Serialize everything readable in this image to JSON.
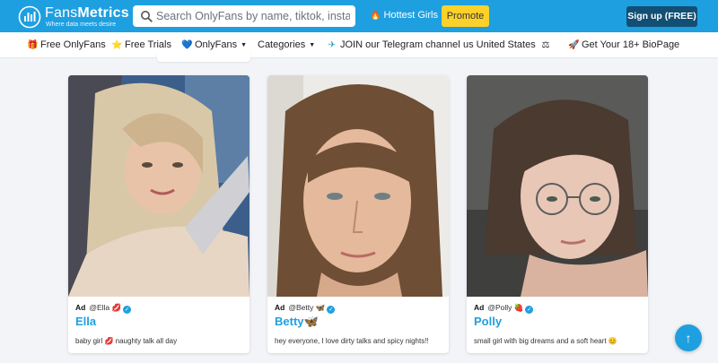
{
  "brand": {
    "name_light": "Fans",
    "name_bold": "Metrics",
    "tagline": "Where data meets desire",
    "logo_icon": "bars-chart-icon"
  },
  "search": {
    "placeholder": "Search OnlyFans by name, tiktok, instagram"
  },
  "header": {
    "hottest_label": "Hottest Girls",
    "hottest_icon": "fire-icon",
    "promote_label": "Promote",
    "signup_label": "Sign up (FREE)"
  },
  "nav": {
    "free_onlyfans": "Free OnlyFans",
    "free_trials": "Free Trials",
    "onlyfans": "OnlyFans",
    "categories": "Categories",
    "telegram": "JOIN our Telegram channel",
    "country": "us United States",
    "biopage": "Get Your 18+ BioPage"
  },
  "cards": [
    {
      "ad": "Ad",
      "handle": "@Ella",
      "handle_emoji": "💋",
      "name": "Ella",
      "bio": "baby girl 💋 naughty talk all day"
    },
    {
      "ad": "Ad",
      "handle": "@Betty",
      "handle_emoji": "🦋",
      "name": "Betty🦋",
      "bio": "hey everyone, I love dirty talks and spicy nights!!"
    },
    {
      "ad": "Ad",
      "handle": "@Polly",
      "handle_emoji": "🍓",
      "name": "Polly",
      "bio": "small girl with big dreams and a soft heart 😊"
    }
  ],
  "scroll_top": {
    "icon": "arrow-up-icon",
    "glyph": "↑"
  },
  "colors": {
    "header_bg": "#1e9fe0",
    "promote_bg": "#fcd12a",
    "signup_bg": "#124f74",
    "name_color": "#1e9fe0"
  }
}
